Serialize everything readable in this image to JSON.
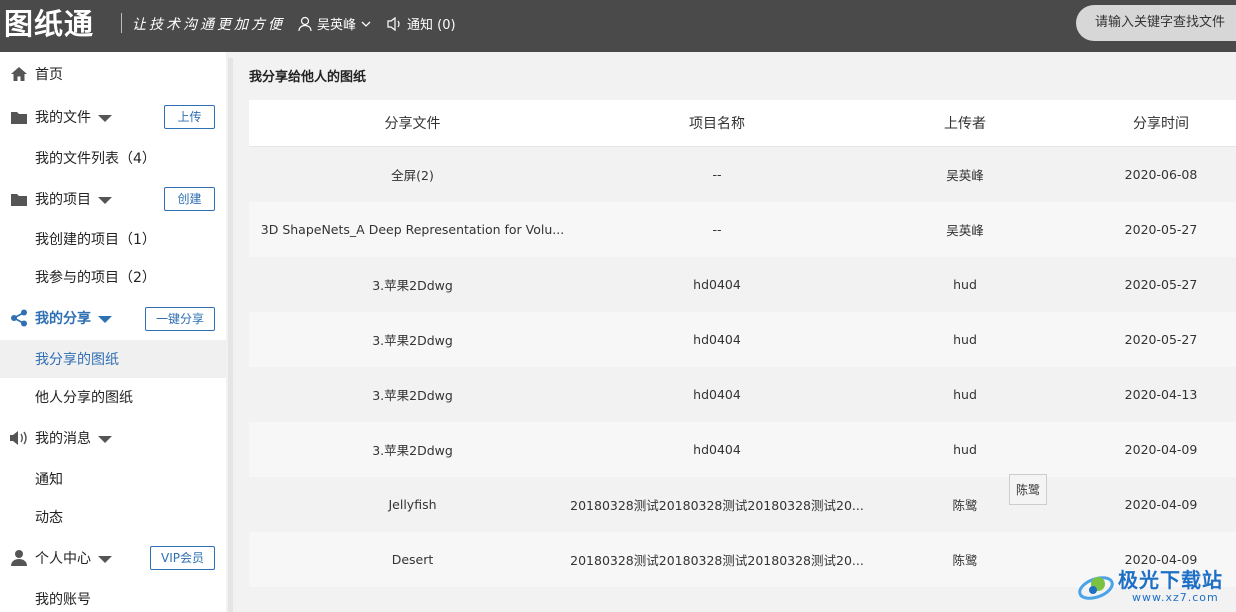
{
  "header": {
    "logo": "图纸通",
    "slogan": "让技术沟通更加方便",
    "user_name": "吴英峰",
    "notice_label": "通知 (0)",
    "search_placeholder": "请输入关键字查找文件"
  },
  "sidebar": {
    "home": "首页",
    "my_files": "我的文件",
    "upload_btn": "上传",
    "file_list": "我的文件列表（4）",
    "my_projects": "我的项目",
    "create_btn": "创建",
    "created_projects": "我创建的项目（1）",
    "joined_projects": "我参与的项目（2）",
    "my_share": "我的分享",
    "share_btn": "一键分享",
    "shared_by_me": "我分享的图纸",
    "shared_by_others": "他人分享的图纸",
    "my_messages": "我的消息",
    "notice": "通知",
    "activity": "动态",
    "personal_center": "个人中心",
    "vip_btn": "VIP会员",
    "my_account": "我的账号"
  },
  "main": {
    "title": "我分享给他人的图纸",
    "columns": [
      "分享文件",
      "项目名称",
      "上传者",
      "分享时间"
    ],
    "rows": [
      {
        "file": "全屏(2)",
        "project": "--",
        "uploader": "吴英峰",
        "time": "2020-06-08"
      },
      {
        "file": "3D ShapeNets_A Deep Representation for Volu...",
        "project": "--",
        "uploader": "吴英峰",
        "time": "2020-05-27"
      },
      {
        "file": "3.苹果2Ddwg",
        "project": "hd0404",
        "uploader": "hud",
        "time": "2020-05-27"
      },
      {
        "file": "3.苹果2Ddwg",
        "project": "hd0404",
        "uploader": "hud",
        "time": "2020-05-27"
      },
      {
        "file": "3.苹果2Ddwg",
        "project": "hd0404",
        "uploader": "hud",
        "time": "2020-04-13"
      },
      {
        "file": "3.苹果2Ddwg",
        "project": "hd0404",
        "uploader": "hud",
        "time": "2020-04-09"
      },
      {
        "file": "Jellyfish",
        "project": "20180328测试20180328测试20180328测试20...",
        "uploader": "陈鹭",
        "time": "2020-04-09"
      },
      {
        "file": "Desert",
        "project": "20180328测试20180328测试20180328测试20...",
        "uploader": "陈鹭",
        "time": "2020-04-09"
      }
    ],
    "tooltip": "陈鹭"
  },
  "watermark": {
    "text": "极光下载站",
    "url": "www.xz7.com"
  }
}
